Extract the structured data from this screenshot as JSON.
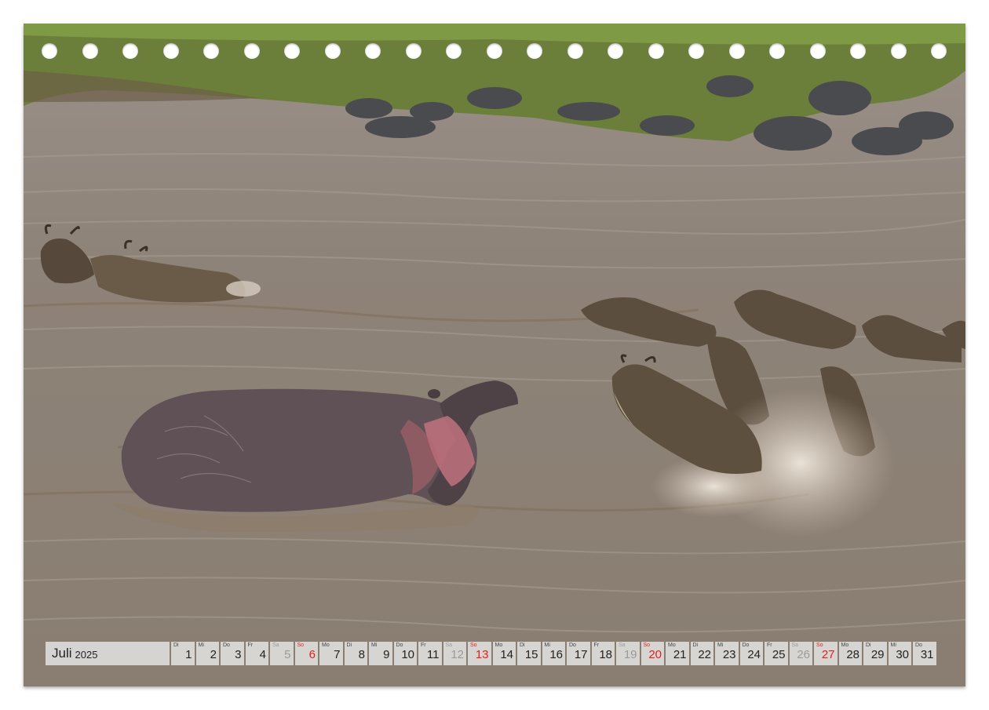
{
  "calendar": {
    "month": "Juli",
    "year": "2025",
    "days": [
      {
        "wd": "Di",
        "n": "1",
        "type": "week"
      },
      {
        "wd": "Mi",
        "n": "2",
        "type": "week"
      },
      {
        "wd": "Do",
        "n": "3",
        "type": "week"
      },
      {
        "wd": "Fr",
        "n": "4",
        "type": "week"
      },
      {
        "wd": "Sa",
        "n": "5",
        "type": "sat"
      },
      {
        "wd": "So",
        "n": "6",
        "type": "sun"
      },
      {
        "wd": "Mo",
        "n": "7",
        "type": "week"
      },
      {
        "wd": "Di",
        "n": "8",
        "type": "week"
      },
      {
        "wd": "Mi",
        "n": "9",
        "type": "week"
      },
      {
        "wd": "Do",
        "n": "10",
        "type": "week"
      },
      {
        "wd": "Fr",
        "n": "11",
        "type": "week"
      },
      {
        "wd": "Sa",
        "n": "12",
        "type": "sat"
      },
      {
        "wd": "So",
        "n": "13",
        "type": "sun"
      },
      {
        "wd": "Mo",
        "n": "14",
        "type": "week"
      },
      {
        "wd": "Di",
        "n": "15",
        "type": "week"
      },
      {
        "wd": "Mi",
        "n": "16",
        "type": "week"
      },
      {
        "wd": "Do",
        "n": "17",
        "type": "week"
      },
      {
        "wd": "Fr",
        "n": "18",
        "type": "week"
      },
      {
        "wd": "Sa",
        "n": "19",
        "type": "sat"
      },
      {
        "wd": "So",
        "n": "20",
        "type": "sun"
      },
      {
        "wd": "Mo",
        "n": "21",
        "type": "week"
      },
      {
        "wd": "Di",
        "n": "22",
        "type": "week"
      },
      {
        "wd": "Mi",
        "n": "23",
        "type": "week"
      },
      {
        "wd": "Do",
        "n": "24",
        "type": "week"
      },
      {
        "wd": "Fr",
        "n": "25",
        "type": "week"
      },
      {
        "wd": "Sa",
        "n": "26",
        "type": "sat"
      },
      {
        "wd": "So",
        "n": "27",
        "type": "sun"
      },
      {
        "wd": "Mo",
        "n": "28",
        "type": "week"
      },
      {
        "wd": "Di",
        "n": "29",
        "type": "week"
      },
      {
        "wd": "Mi",
        "n": "30",
        "type": "week"
      },
      {
        "wd": "Do",
        "n": "31",
        "type": "week"
      }
    ]
  },
  "colors": {
    "water": "#8f8478",
    "bank_grass": "#6f8a3c",
    "hippo": "#5f5156",
    "wildebeest": "#5a4c3e",
    "sunday_red": "#e0201c"
  },
  "binding_holes": 23
}
